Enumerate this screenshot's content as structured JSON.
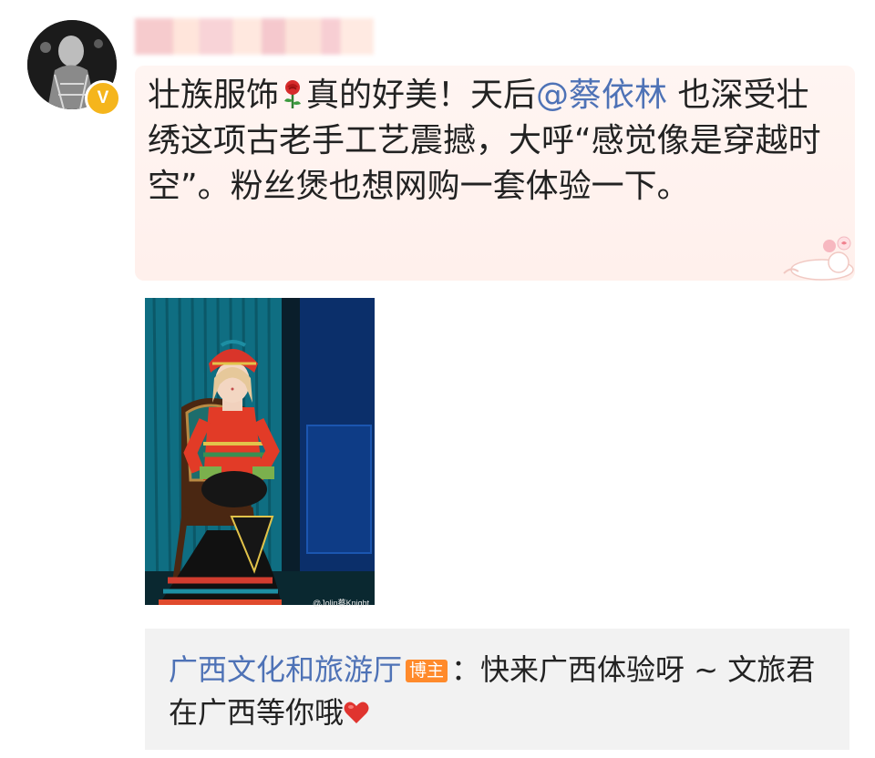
{
  "post": {
    "avatar": {
      "icon": "avatar",
      "verified_badge": "V"
    },
    "username_blurred": true,
    "text": {
      "part1": "壮族服饰",
      "emoji1": "rose-icon",
      "part2": "真的好美！天后",
      "mention": "@蔡依林",
      "part3": " 也深受壮绣这项古老手工艺震撼，大呼“感觉像是穿越时空”。粉丝煲也想网购一套体验一下。"
    },
    "image": {
      "watermark": "@Jolin蔡Knight"
    }
  },
  "comment": {
    "author": "广西文化和旅游厅",
    "badge": "博主",
    "text": "：快来广西体验呀 ~ 文旅君在广西等你哦",
    "emoji": "red-heart-icon"
  },
  "colors": {
    "link": "#4e72b6",
    "badge_orange": "#ff8a2b",
    "verified_gold": "#f5b51c",
    "card_bg": "#fff3ef",
    "comment_bg": "#f2f2f2"
  }
}
